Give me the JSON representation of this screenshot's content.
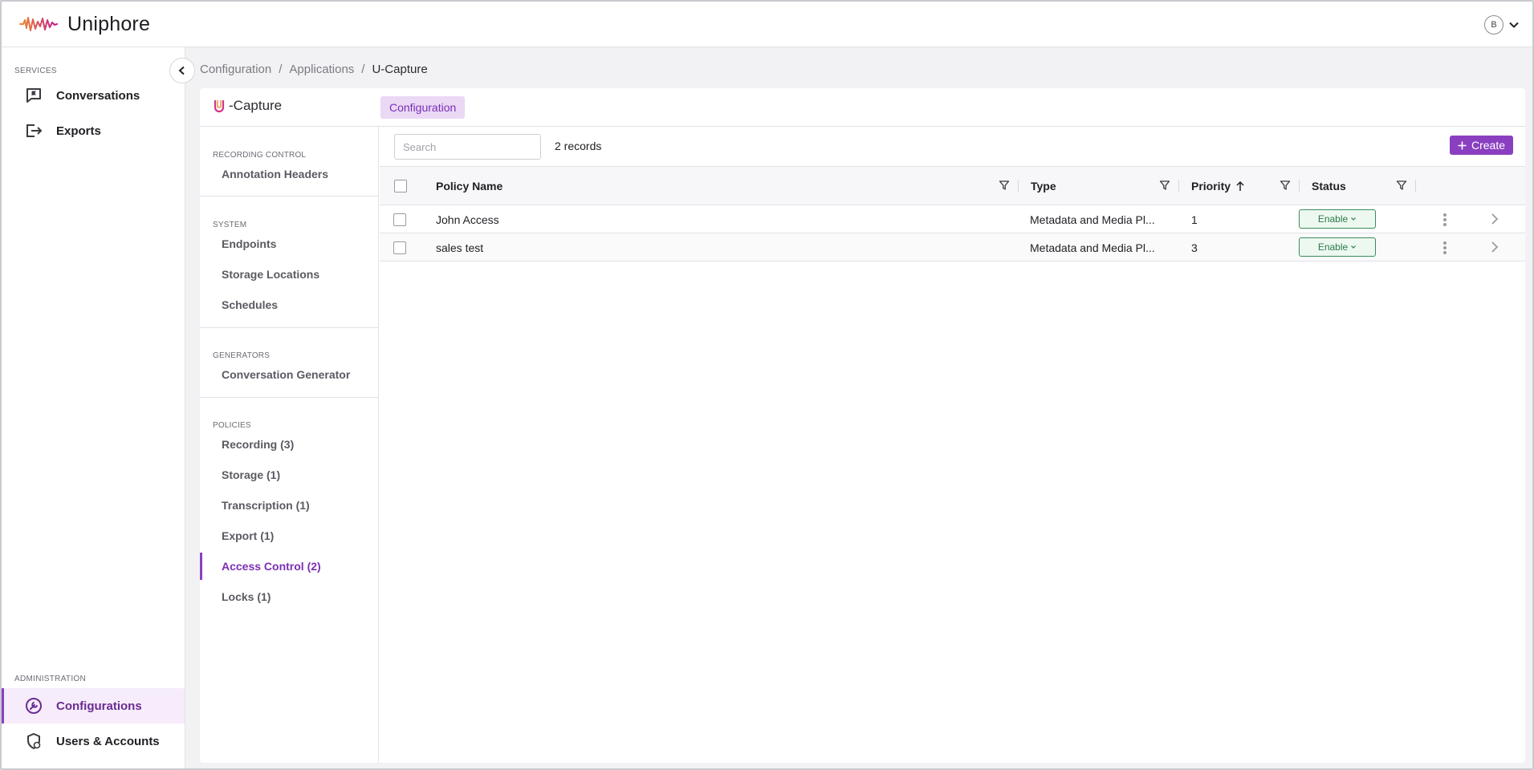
{
  "app": {
    "brand": "Uniphore"
  },
  "user": {
    "initial": "B"
  },
  "sidebar": {
    "services_label": "SERVICES",
    "admin_label": "ADMINISTRATION",
    "items": [
      {
        "label": "Conversations",
        "icon": "chat-icon"
      },
      {
        "label": "Exports",
        "icon": "export-icon"
      },
      {
        "label": "Configurations",
        "icon": "wrench-icon"
      },
      {
        "label": "Users & Accounts",
        "icon": "shield-user-icon"
      }
    ]
  },
  "breadcrumb": {
    "items": [
      "Configuration",
      "Applications",
      "U-Capture"
    ],
    "separator": "/"
  },
  "panel": {
    "app_name": "-Capture",
    "tab_label": "Configuration"
  },
  "subnav": {
    "sections": [
      {
        "label": "RECORDING CONTROL",
        "items": [
          "Annotation Headers"
        ]
      },
      {
        "label": "SYSTEM",
        "items": [
          "Endpoints",
          "Storage Locations",
          "Schedules"
        ]
      },
      {
        "label": "GENERATORS",
        "items": [
          "Conversation Generator"
        ]
      },
      {
        "label": "POLICIES",
        "items": [
          "Recording (3)",
          "Storage (1)",
          "Transcription (1)",
          "Export (1)",
          "Access Control (2)",
          "Locks (1)"
        ]
      }
    ],
    "active": "Access Control (2)"
  },
  "toolbar": {
    "search_placeholder": "Search",
    "records": "2 records",
    "create_label": "Create"
  },
  "table": {
    "columns": [
      "Policy Name",
      "Type",
      "Priority",
      "Status"
    ],
    "rows": [
      {
        "name": "John Access",
        "type": "Metadata and Media Pl...",
        "priority": "1",
        "status": "Enable"
      },
      {
        "name": "sales test",
        "type": "Metadata and Media Pl...",
        "priority": "3",
        "status": "Enable"
      }
    ]
  },
  "colors": {
    "accent": "#8a3fc0",
    "active_bg": "#f6ecfb",
    "status_green": "#2a7a48"
  }
}
